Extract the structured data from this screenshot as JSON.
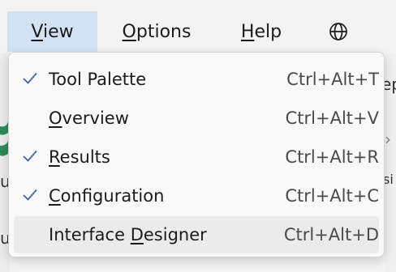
{
  "menubar": {
    "items": [
      {
        "pre": "",
        "accel": "V",
        "post": "iew"
      },
      {
        "pre": "",
        "accel": "O",
        "post": "ptions"
      },
      {
        "pre": "",
        "accel": "H",
        "post": "elp"
      }
    ],
    "globe_icon": "globe-icon"
  },
  "dropdown": {
    "items": [
      {
        "pre": "Tool Palette",
        "accel": "",
        "post": "",
        "shortcut": "Ctrl+Alt+T",
        "checked": true
      },
      {
        "pre": "",
        "accel": "O",
        "post": "verview",
        "shortcut": "Ctrl+Alt+V",
        "checked": false
      },
      {
        "pre": "",
        "accel": "R",
        "post": "esults",
        "shortcut": "Ctrl+Alt+R",
        "checked": true
      },
      {
        "pre": "",
        "accel": "C",
        "post": "onfiguration",
        "shortcut": "Ctrl+Alt+C",
        "checked": true
      },
      {
        "pre": "Interface ",
        "accel": "D",
        "post": "esigner",
        "shortcut": "Ctrl+Alt+D",
        "checked": false
      }
    ],
    "check_icon": "check-icon",
    "hover_index": 4
  },
  "background": {
    "right_fragments": [
      "ep",
      "›",
      "si"
    ],
    "left_fragments": [
      "u",
      "u"
    ],
    "accent_green": "#2e8b57"
  },
  "colors": {
    "menubar_bg": "#f3f3f3",
    "active_menu_bg": "#d3e2f3",
    "dropdown_bg": "#f9f9f9",
    "hover_bg": "#ebebeb",
    "check_color": "#3a6a9c"
  }
}
